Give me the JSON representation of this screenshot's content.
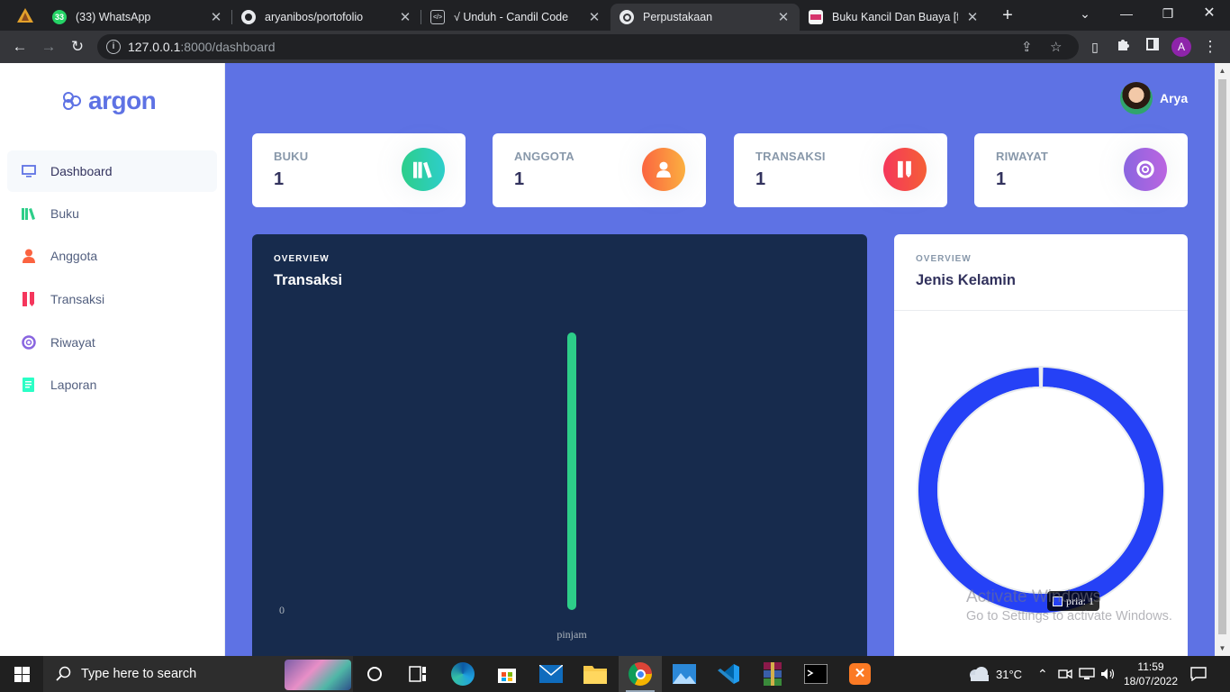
{
  "browser": {
    "tabs": [
      {
        "title": "(33) WhatsApp",
        "icon": "whatsapp-icon"
      },
      {
        "title": "aryanibos/portofolio",
        "icon": "github-icon"
      },
      {
        "title": "√ Unduh - Candil Code",
        "icon": "page-icon"
      },
      {
        "title": "Perpustakaan",
        "icon": "argon-icon",
        "active": true
      },
      {
        "title": "Buku Kancil Dan Buaya [full",
        "icon": "book-icon"
      }
    ],
    "url_host": "127.0.0.1",
    "url_path": ":8000/dashboard",
    "profile_initial": "A"
  },
  "sidebar": {
    "brand": "argon",
    "items": [
      {
        "label": "Dashboard",
        "icon": "tv-icon",
        "color": "#5e72e4"
      },
      {
        "label": "Buku",
        "icon": "books-icon",
        "color": "#2dce89"
      },
      {
        "label": "Anggota",
        "icon": "person-icon",
        "color": "#fb6340"
      },
      {
        "label": "Transaksi",
        "icon": "ruler-pencil-icon",
        "color": "#f5365c"
      },
      {
        "label": "Riwayat",
        "icon": "support-icon",
        "color": "#8965e0"
      },
      {
        "label": "Laporan",
        "icon": "paper-icon",
        "color": "#2bffc6"
      }
    ]
  },
  "user": {
    "name": "Arya"
  },
  "stats": [
    {
      "label": "BUKU",
      "value": "1",
      "icon": "books-icon",
      "color": "#2dce89"
    },
    {
      "label": "ANGGOTA",
      "value": "1",
      "icon": "person-icon",
      "color": "#fb6340"
    },
    {
      "label": "TRANSAKSI",
      "value": "1",
      "icon": "ruler-pencil-icon",
      "color": "#f5365c"
    },
    {
      "label": "RIWAYAT",
      "value": "1",
      "icon": "support-icon",
      "color": "#8965e0"
    }
  ],
  "transaksi_card": {
    "overline": "OVERVIEW",
    "title": "Transaksi"
  },
  "gender_card": {
    "overline": "OVERVIEW",
    "title": "Jenis Kelamin",
    "tooltip": "pria: 1"
  },
  "chart_data": [
    {
      "type": "bar",
      "title": "Transaksi",
      "categories": [
        "pinjam"
      ],
      "values": [
        1
      ],
      "y_tick_labels": [
        "0"
      ],
      "color": "#2dce89"
    },
    {
      "type": "pie",
      "title": "Jenis Kelamin",
      "labels": [
        "pria"
      ],
      "values": [
        1
      ],
      "color": "#2541f6"
    }
  ],
  "watermark": {
    "line1": "Activate Windows",
    "line2": "Go to Settings to activate Windows."
  },
  "taskbar": {
    "search_placeholder": "Type here to search",
    "temperature": "31°C",
    "time": "11:59",
    "date": "18/07/2022"
  }
}
